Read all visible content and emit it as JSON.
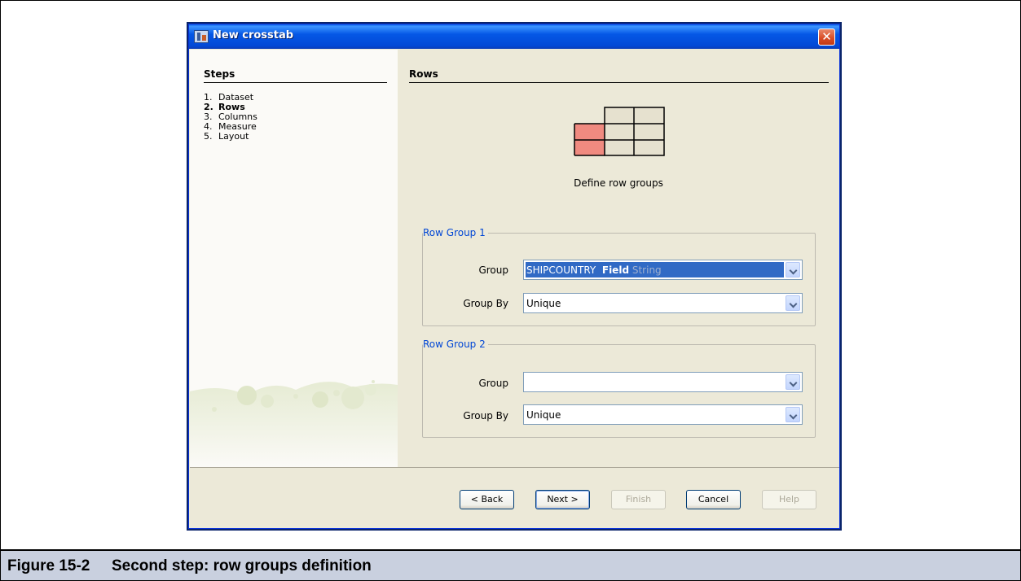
{
  "window": {
    "title": "New crosstab",
    "close_glyph": "✕"
  },
  "steps": {
    "title": "Steps",
    "items": [
      {
        "num": "1.",
        "label": "Dataset"
      },
      {
        "num": "2.",
        "label": "Rows"
      },
      {
        "num": "3.",
        "label": "Columns"
      },
      {
        "num": "4.",
        "label": "Measure"
      },
      {
        "num": "5.",
        "label": "Layout"
      }
    ]
  },
  "content": {
    "title": "Rows",
    "instruction": "Define row groups",
    "row_groups": [
      {
        "legend": "Row Group 1",
        "group_label": "Group",
        "group_field": "SHIPCOUNTRY",
        "group_kind": "Field",
        "group_type": "String",
        "group_by_label": "Group By",
        "group_by_value": "Unique"
      },
      {
        "legend": "Row Group 2",
        "group_label": "Group",
        "group_field": "",
        "group_by_label": "Group By",
        "group_by_value": "Unique"
      }
    ]
  },
  "buttons": {
    "back": "< Back",
    "next": "Next >",
    "finish": "Finish",
    "cancel": "Cancel",
    "help": "Help"
  },
  "caption": {
    "number": "Figure 15-2",
    "text": "Second step: row groups definition"
  },
  "colors": {
    "titlebar": "#0558e6",
    "selection": "#316ac5",
    "legend_text": "#0046d5",
    "row_header_cell": "#f08a80",
    "grid_cell": "#e6e1cf"
  }
}
